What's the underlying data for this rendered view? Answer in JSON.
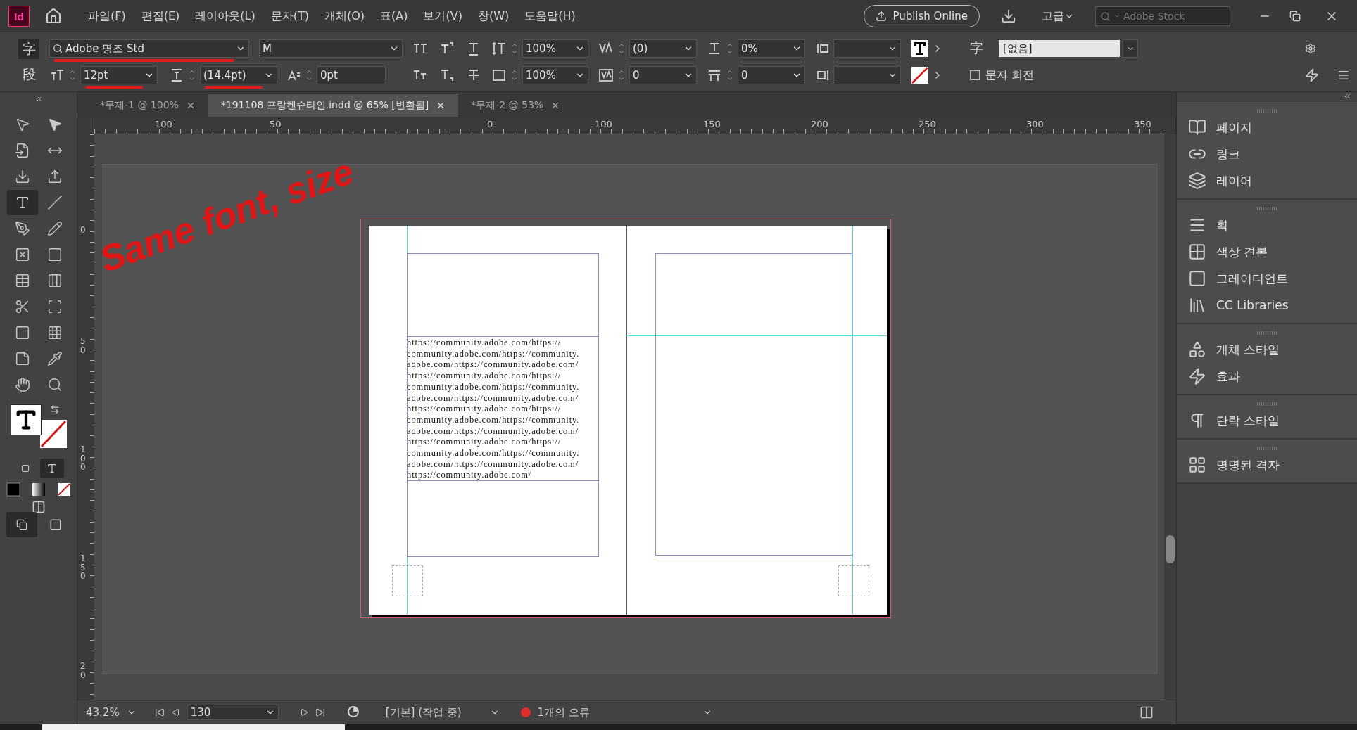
{
  "app_logo": "Id",
  "menu": [
    "파일(F)",
    "편집(E)",
    "레이아웃(L)",
    "문자(T)",
    "개체(O)",
    "표(A)",
    "보기(V)",
    "창(W)",
    "도움말(H)"
  ],
  "publish_button": "Publish Online",
  "workspace": "고급",
  "search": {
    "placeholder": "Adobe Stock"
  },
  "control_panel": {
    "modes": [
      {
        "label": "字",
        "selected": true
      },
      {
        "label": "段",
        "selected": false
      }
    ],
    "font_family": {
      "value": "Adobe 명조 Std",
      "marked": true
    },
    "font_style": {
      "value": "M"
    },
    "font_size": {
      "value": "12pt",
      "marked": true
    },
    "leading": {
      "value": "(14.4pt)",
      "marked": true
    },
    "baseline_shift": {
      "value": "0pt"
    },
    "vertical_scale": {
      "value": "100%"
    },
    "horizontal_scale": {
      "value": "100%"
    },
    "kerning": {
      "value": "(0)"
    },
    "tracking": {
      "value": "0"
    },
    "ratio": {
      "value": "0%"
    },
    "grid": {
      "value": "0"
    },
    "style_label": "字",
    "character_style": "[없음]",
    "rotate_characters": {
      "label": "문자 회전",
      "checked": false
    }
  },
  "tabs": [
    {
      "label": "*무제-1 @ 100%",
      "selected": false
    },
    {
      "label": "*191108 프랑켄슈타인.indd @ 65% [변환됨]",
      "selected": true
    },
    {
      "label": "*무제-2 @ 53%",
      "selected": false
    }
  ],
  "h_ruler": [
    "100",
    "50",
    "0",
    "100",
    "150",
    "200",
    "250",
    "300",
    "350"
  ],
  "v_ruler": [
    "0",
    "50",
    "100",
    "150",
    "20"
  ],
  "toolbar": {
    "tools": [
      {
        "selected": false
      },
      {
        "selected": false
      },
      {
        "selected": false
      },
      {
        "selected": false
      },
      {
        "selected": false
      },
      {
        "selected": false
      },
      {
        "selected": true
      },
      {
        "selected": false
      },
      {
        "selected": false
      },
      {
        "selected": false
      },
      {
        "selected": false
      },
      {
        "selected": false
      },
      {
        "selected": false
      },
      {
        "selected": false
      },
      {
        "selected": false
      },
      {
        "selected": false
      },
      {
        "selected": false
      },
      {
        "selected": false
      },
      {
        "selected": false
      },
      {
        "selected": false
      },
      {
        "selected": false
      },
      {
        "selected": false
      }
    ],
    "formatting_target": [
      {
        "selected": false
      },
      {
        "selected": true
      }
    ],
    "screen_modes": [
      {
        "selected": true
      },
      {
        "selected": false
      }
    ]
  },
  "text_frame": {
    "lines": [
      "https://community.adobe.com/https://",
      "community.adobe.com/https://community.",
      "adobe.com/https://community.adobe.com/",
      "https://community.adobe.com/https://",
      "community.adobe.com/https://community.",
      "adobe.com/https://community.adobe.com/",
      "https://community.adobe.com/https://",
      "community.adobe.com/https://community.",
      "adobe.com/https://community.adobe.com/",
      "https://community.adobe.com/https://",
      "community.adobe.com/https://community.",
      "adobe.com/https://community.adobe.com/",
      "https://community.adobe.com/"
    ]
  },
  "annotation": {
    "text": "Same font, size"
  },
  "panels": [
    [
      "페이지",
      "링크",
      "레이어"
    ],
    [
      "획",
      "색상 견본",
      "그레이디언트",
      "CC Libraries"
    ],
    [
      "개체 스타일",
      "효과"
    ],
    [
      "단락 스타일"
    ],
    [
      "명명된 격자"
    ]
  ],
  "status_bar": {
    "zoom": "43.2%",
    "page": "130",
    "preflight_profile": "[기본] (작업 중)",
    "errors": "1개의 오류"
  }
}
